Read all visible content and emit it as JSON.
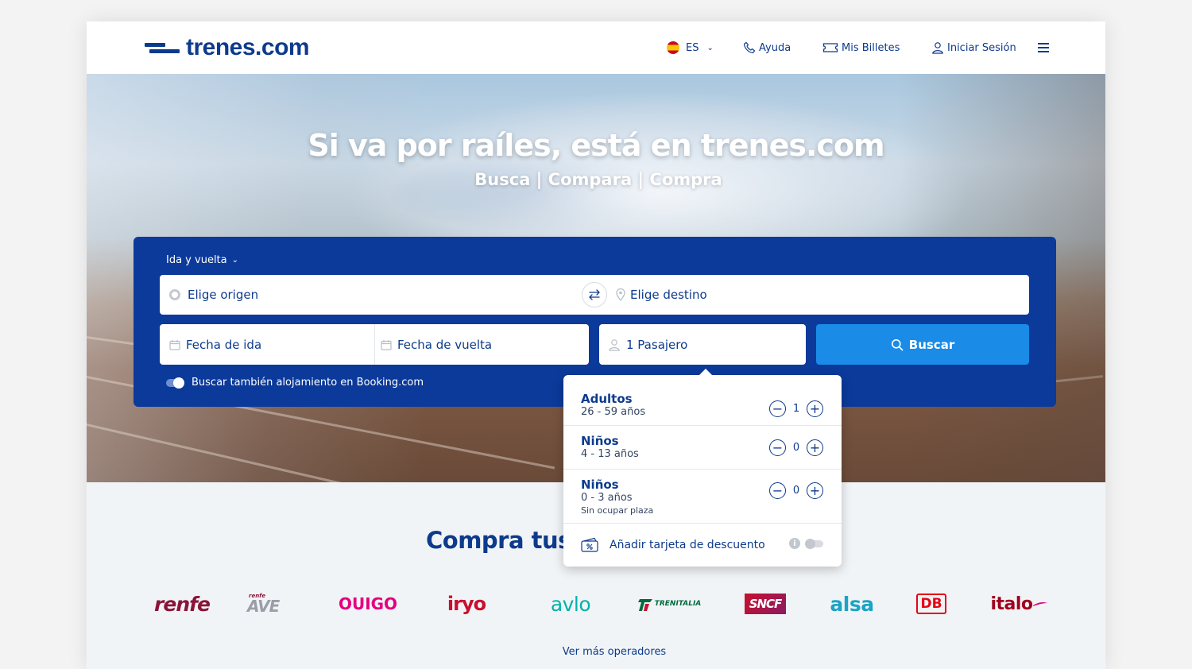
{
  "header": {
    "logo_text": "trenes.com",
    "lang": "ES",
    "help": "Ayuda",
    "tickets": "Mis Billetes",
    "login": "Iniciar Sesión"
  },
  "hero": {
    "title": "Si va por raíles, está en trenes.com",
    "subtitle": "Busca | Compara | Compra"
  },
  "search": {
    "trip_type": "Ida y vuelta",
    "origin_placeholder": "Elige origen",
    "destination_placeholder": "Elige destino",
    "date_out_placeholder": "Fecha de ida",
    "date_back_placeholder": "Fecha de vuelta",
    "passengers": "1 Pasajero",
    "search_button": "Buscar",
    "booking_label": "Buscar también alojamiento en Booking.com"
  },
  "passengers_popup": {
    "rows": [
      {
        "name": "Adultos",
        "age": "26 - 59 años",
        "note": "",
        "count": "1"
      },
      {
        "name": "Niños",
        "age": "4 - 13 años",
        "note": "",
        "count": "0"
      },
      {
        "name": "Niños",
        "age": "0 - 3 años",
        "note": "Sin ocupar plaza",
        "count": "0"
      }
    ],
    "discount_label": "Añadir tarjeta de descuento"
  },
  "main": {
    "section_title": "Compra tus",
    "operators": [
      "renfe",
      "AVE",
      "OUIGO",
      "iryo",
      "avlo",
      "TRENITALIA",
      "SNCF",
      "alsa",
      "DB",
      "italo"
    ],
    "ave_prefix": "renfe",
    "more_operators": "Ver más operadores"
  },
  "colors": {
    "brand_navy": "#0d3b8c",
    "panel_blue": "#0b3a9b",
    "button_blue": "#1a8be7",
    "renfe": "#8a1538",
    "ouigo": "#e4007f",
    "iryo": "#c8102e",
    "avlo": "#00b2a9",
    "trenitalia": "#006b3f",
    "sncf": "#c8102e",
    "alsa": "#1aa3c4",
    "db": "#e30613",
    "italo": "#a0001e"
  }
}
